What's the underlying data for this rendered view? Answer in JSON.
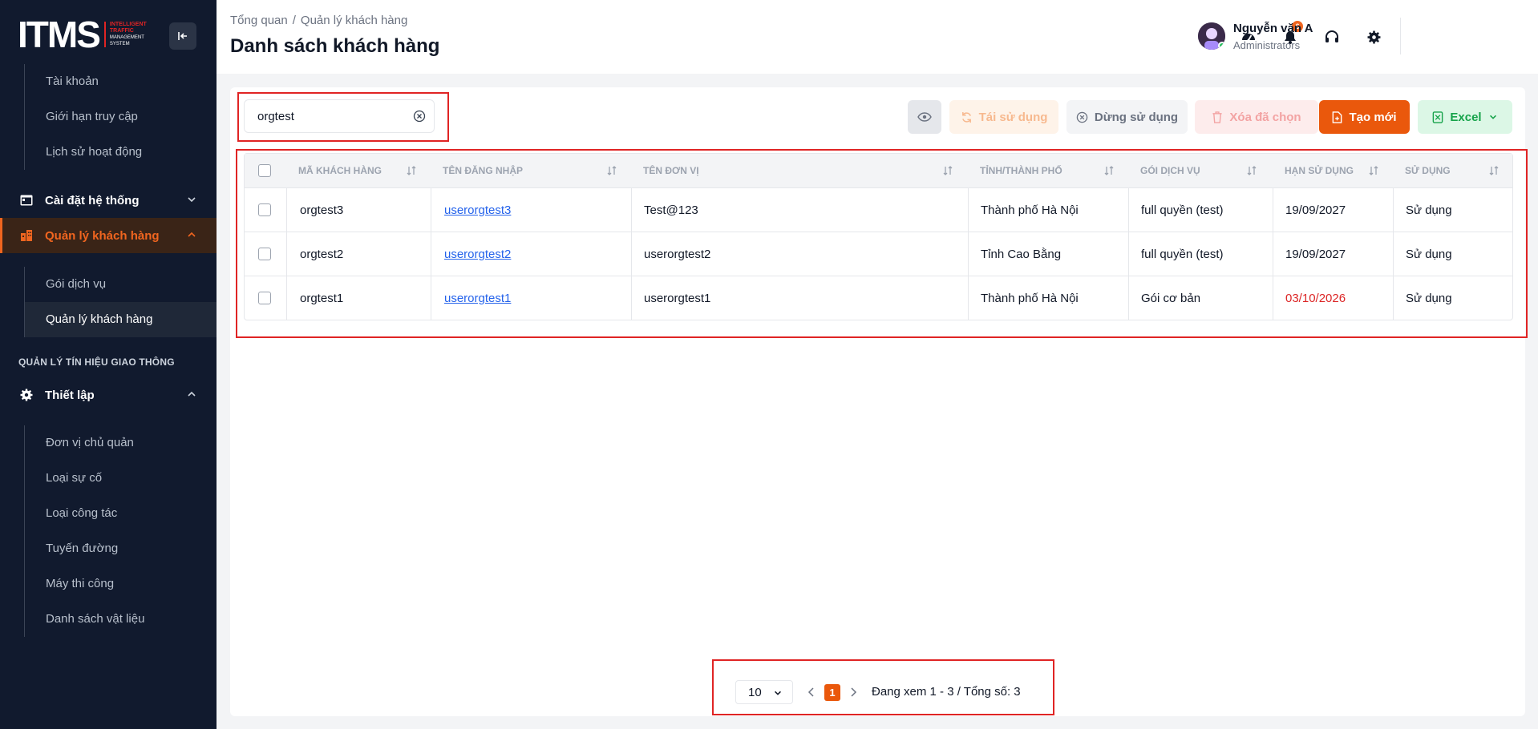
{
  "brand": {
    "logo_main": "ITMS",
    "logo_line1": "INTELLIGENT",
    "logo_line2": "TRAFFIC",
    "logo_line3": "MANAGEMENT",
    "logo_line4": "SYSTEM"
  },
  "sidebar": {
    "top_items": [
      "Tài khoản",
      "Giới hạn truy cập",
      "Lịch sử hoạt động"
    ],
    "group_system": "Cài đặt hệ thống",
    "group_customers": "Quản lý khách hàng",
    "customer_items": [
      "Gói dịch vụ",
      "Quản lý khách hàng"
    ],
    "section_traffic": "QUẢN LÝ TÍN HIỆU GIAO THÔNG",
    "group_setup": "Thiết lập",
    "setup_items": [
      "Đơn vị chủ quản",
      "Loại sự cố",
      "Loại công tác",
      "Tuyến đường",
      "Máy thi công",
      "Danh sách vật liệu"
    ]
  },
  "header": {
    "breadcrumb_home": "Tổng quan",
    "breadcrumb_sep": "/",
    "breadcrumb_current": "Quản lý khách hàng",
    "title": "Danh sách khách hàng",
    "notification_count": "6",
    "user_name": "Nguyễn văn A",
    "user_role": "Administrators"
  },
  "toolbar": {
    "search_value": "orgtest",
    "reuse_label": "Tái sử dụng",
    "stop_label": "Dừng sử dụng",
    "delete_label": "Xóa đã chọn",
    "new_label": "Tạo mới",
    "excel_label": "Excel"
  },
  "table": {
    "columns": [
      "MÃ KHÁCH HÀNG",
      "TÊN ĐĂNG NHẬP",
      "TÊN ĐƠN VỊ",
      "TỈNH/THÀNH PHỐ",
      "GÓI DỊCH VỤ",
      "HẠN SỬ DỤNG",
      "SỬ DỤNG"
    ],
    "rows": [
      {
        "code": "orgtest3",
        "username": "userorgtest3",
        "unit": "Test@123",
        "province": "Thành phố Hà Nội",
        "plan": "full quyền (test)",
        "expiry": "19/09/2027",
        "status": "Sử dụng"
      },
      {
        "code": "orgtest2",
        "username": "userorgtest2",
        "unit": "userorgtest2",
        "province": "Tỉnh Cao Bằng",
        "plan": "full quyền (test)",
        "expiry": "19/09/2027",
        "status": "Sử dụng"
      },
      {
        "code": "orgtest1",
        "username": "userorgtest1",
        "unit": "userorgtest1",
        "province": "Thành phố Hà Nội",
        "plan": "Gói cơ bản",
        "expiry": "03/10/2026",
        "status": "Sử dụng"
      }
    ]
  },
  "pagination": {
    "page_size": "10",
    "current_page": "1",
    "info": "Đang xem 1 - 3 / Tổng số: 3"
  },
  "colors": {
    "accent": "#ea580c",
    "sidebar_bg": "#111a2e",
    "highlight": "#e02424",
    "expired": "#dc2626"
  }
}
